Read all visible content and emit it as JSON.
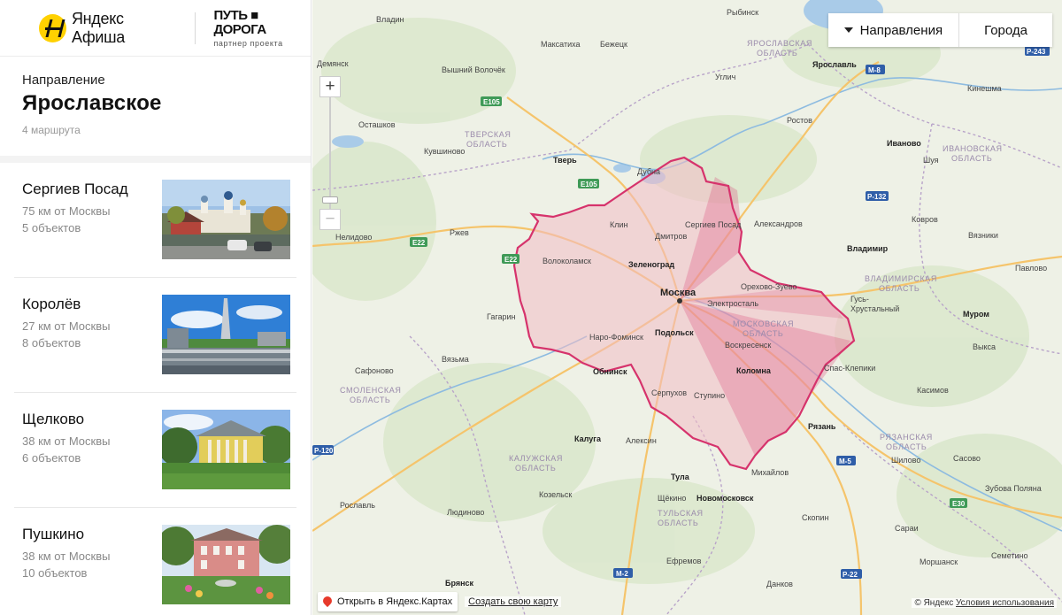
{
  "brand": {
    "afisha_prefix": "Яндекс",
    "afisha_name": "Афиша",
    "partner_name": "ПУТЬ ■ ДОРОГА",
    "partner_sub": "партнер проекта"
  },
  "direction": {
    "label": "Направление",
    "title": "Ярославское",
    "count": "4 маршрута"
  },
  "routes": [
    {
      "name": "Сергиев Посад",
      "distance": "75 км от Москвы",
      "objects": "5 объектов"
    },
    {
      "name": "Королёв",
      "distance": "27 км от Москвы",
      "objects": "8 объектов"
    },
    {
      "name": "Щелково",
      "distance": "38 км от Москвы",
      "objects": "6 объектов"
    },
    {
      "name": "Пушкино",
      "distance": "38 км от Москвы",
      "objects": "10 объектов"
    }
  ],
  "map": {
    "zoom_in": "+",
    "zoom_out": "−",
    "btn_directions": "Направления",
    "btn_cities": "Города",
    "open_yandex": "Открыть в Яндекс.Картах",
    "create_map": "Создать свою карту",
    "copyright": "© Яндекс",
    "terms": "Условия использования",
    "accent_color": "#d6336c",
    "labels": {
      "rybinsk": "Рыбинск",
      "vladin": "Владин",
      "demyansk": "Демянск",
      "maksatikha": "Максатиха",
      "bezheck": "Бежецк",
      "yaroslavskaya": "ЯРОСЛАВСКАЯ",
      "oblast": "ОБЛАСТЬ",
      "yaroslavl": "Ярославль",
      "vvolochek": "Вышний Волочёк",
      "uglich": "Углич",
      "kineshma": "Кинешма",
      "ostashkov": "Осташков",
      "tverskaya": "ТВЕРСКАЯ",
      "rostov": "Ростов",
      "ivanovo": "Иваново",
      "kuvshinovo": "Кувшиново",
      "ivanovskaya": "ИВАНОВСКАЯ",
      "tver": "Тверь",
      "dubna": "Дубна",
      "shuya": "Шуя",
      "klin": "Клин",
      "sposad": "Сергиев Посад",
      "aleksandrov": "Александров",
      "kovrov": "Ковров",
      "nelidovo": "Нелидово",
      "rzhev": "Ржев",
      "dmitrov": "Дмитров",
      "vyazniki": "Вязники",
      "vladimir": "Владимир",
      "volokolamsk": "Волоколамск",
      "zelenograd": "Зеленоград",
      "pavlovo": "Павлово",
      "moskva": "Москва",
      "orekhovo": "Орехово-Зуево",
      "vladimirskaya": "ВЛАДИМИРСКАЯ",
      "elektrostal": "Электросталь",
      "gusk": "Гусь-",
      "khrustalny": "Хрустальный",
      "gagarin": "Гагарин",
      "moskovskaya": "МОСКОВСКАЯ",
      "murom": "Муром",
      "podolsk": "Подольск",
      "nfominsk": "Наро-Фоминск",
      "voskresensk": "Воскресенск",
      "vyksa": "Выкса",
      "vyazma": "Вязьма",
      "obninsk": "Обнинск",
      "kolomna": "Коломна",
      "safonovo": "Сафоново",
      "sklepiki": "Спас-Клепики",
      "serpukhov": "Серпухов",
      "kasimov": "Касимов",
      "smolenskaya": "СМОЛЕНСКАЯ",
      "stupino": "Ступино",
      "ryazan": "Рязань",
      "kaluga": "Калуга",
      "aleksin": "Алексин",
      "ryazanskaya": "РЯЗАНСКАЯ",
      "shilovo": "Шилово",
      "kaluzhskaya": "КАЛУЖСКАЯ",
      "mikhaylov": "Михайлов",
      "sasovo": "Сасово",
      "tula": "Тула",
      "zubova": "Зубова Поляна",
      "kozelsk": "Козельск",
      "schekino": "Щёкино",
      "novomoskovsk": "Новомосковск",
      "roslavl": "Рославль",
      "tulskaya": "ТУЛЬСКАЯ",
      "skopin": "Скопин",
      "ludinovo": "Людиново",
      "sarai": "Сараи",
      "morshansk": "Моршанск",
      "semetino": "Семетино",
      "bryansk": "Брянск",
      "efremov": "Ефремов",
      "dankov": "Данков",
      "e105": "E105",
      "e22": "E22",
      "m8": "M-8",
      "r243": "P-243",
      "r132": "P-132",
      "m5": "M-5",
      "e30": "E30",
      "r120": "P-120",
      "m2": "M-2",
      "r22": "P-22"
    }
  }
}
